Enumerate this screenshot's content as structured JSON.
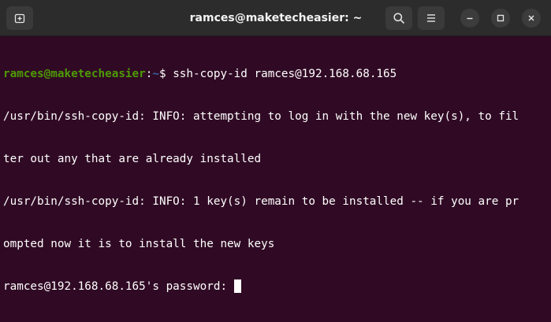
{
  "window": {
    "title": "ramces@maketecheasier: ~"
  },
  "titlebar_icons": {
    "new_tab": "new-tab-icon",
    "search": "search-icon",
    "menu": "hamburger-menu-icon",
    "minimize": "minimize-icon",
    "maximize": "maximize-icon",
    "close": "close-icon"
  },
  "terminal": {
    "prompt_user": "ramces@maketecheasier",
    "prompt_sep": ":",
    "prompt_path": "~",
    "prompt_symbol": "$ ",
    "command": "ssh-copy-id ramces@192.168.68.165",
    "output_lines": [
      "/usr/bin/ssh-copy-id: INFO: attempting to log in with the new key(s), to fil",
      "ter out any that are already installed",
      "/usr/bin/ssh-copy-id: INFO: 1 key(s) remain to be installed -- if you are pr",
      "ompted now it is to install the new keys"
    ],
    "password_prompt": "ramces@192.168.68.165's password: "
  },
  "colors": {
    "terminal_bg": "#300a24",
    "titlebar_bg": "#2c2c2c",
    "prompt_user": "#4e9a06",
    "prompt_path": "#3465a4",
    "text": "#ffffff"
  }
}
